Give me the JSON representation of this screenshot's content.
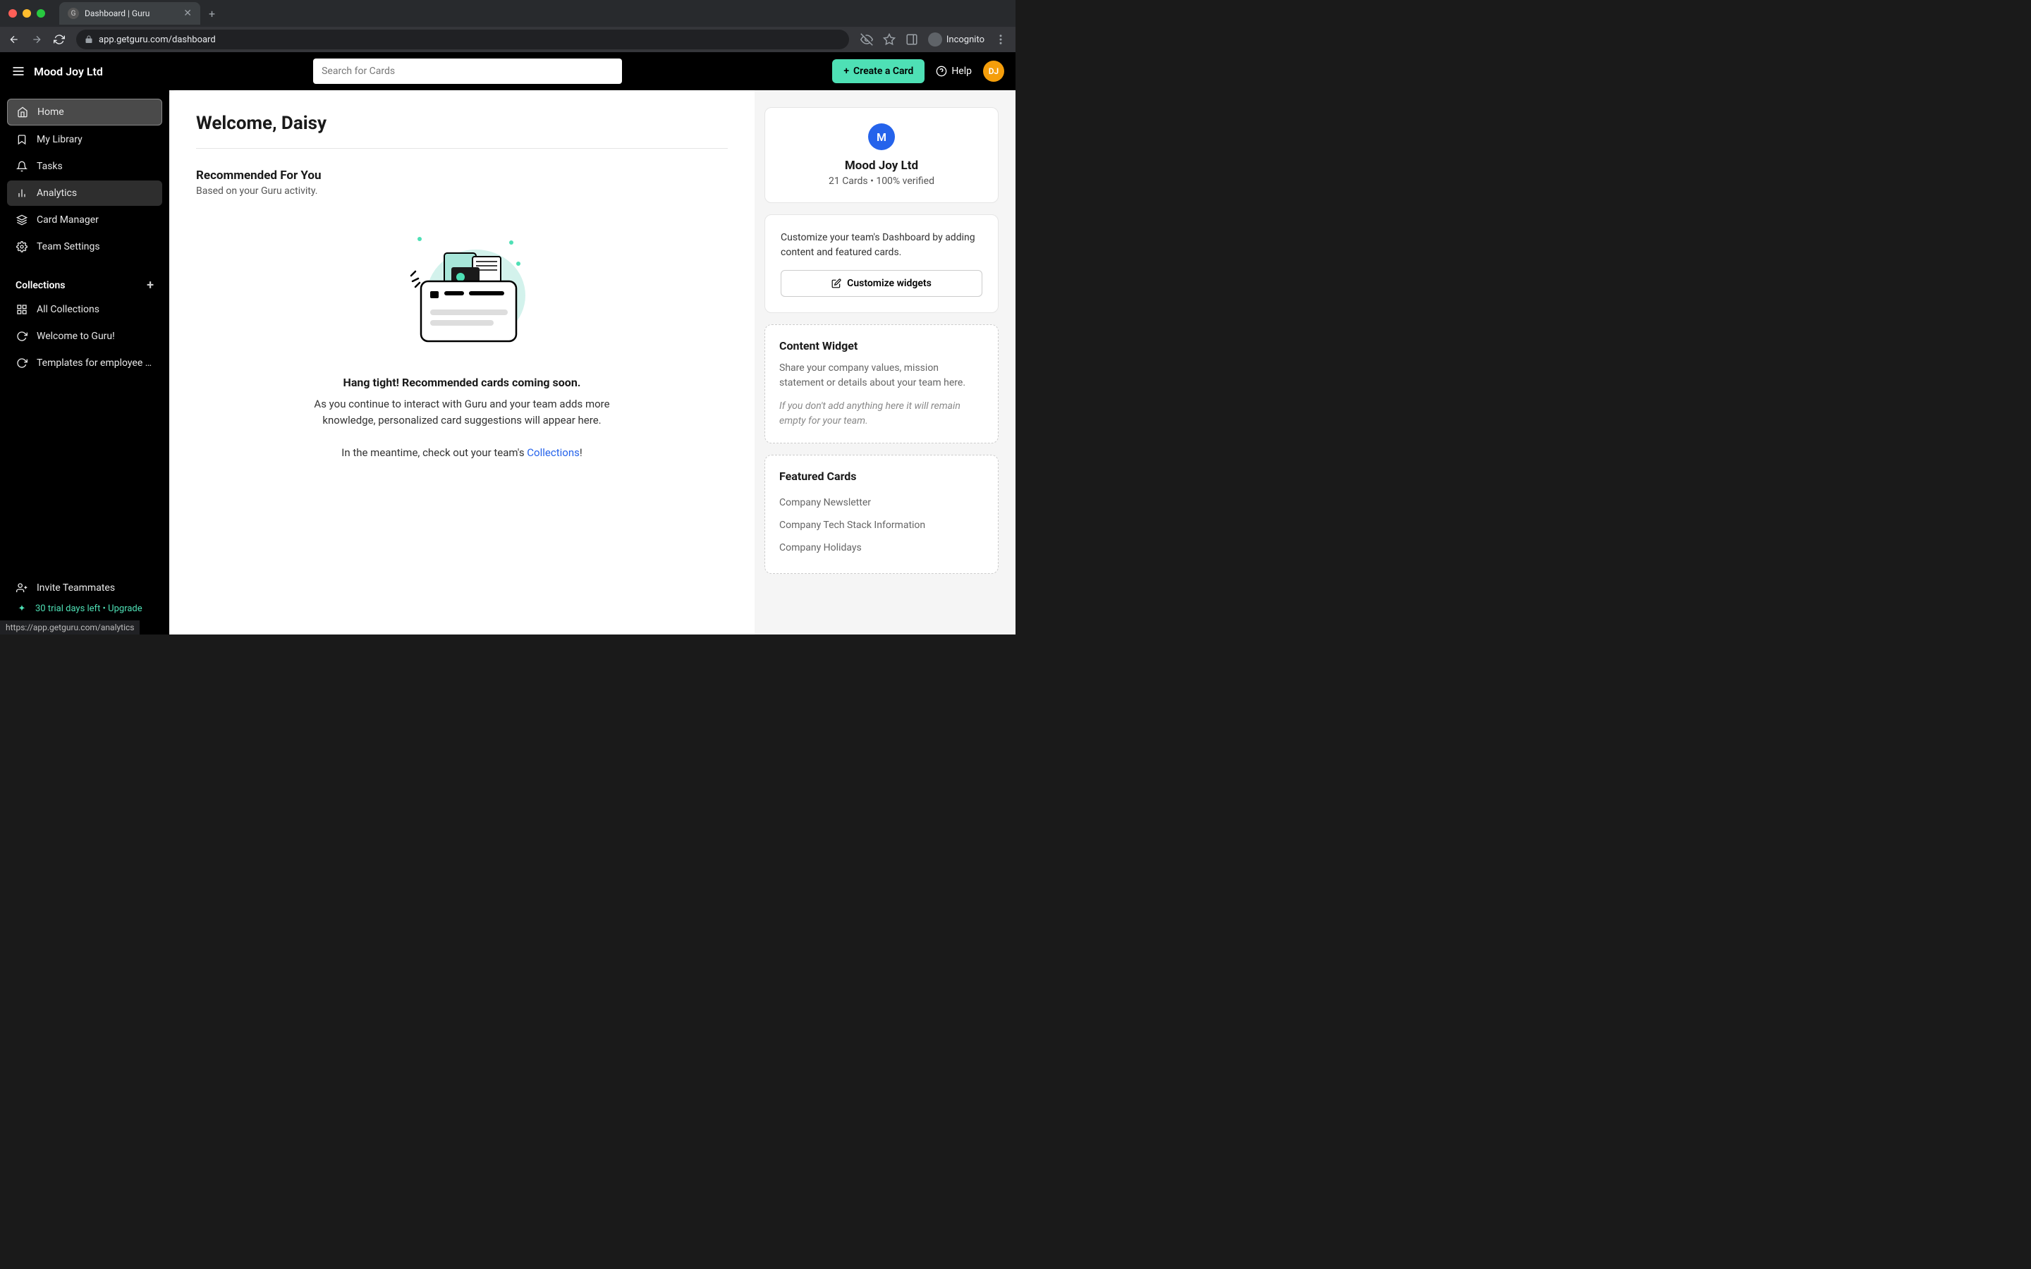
{
  "browser": {
    "tab_title": "Dashboard | Guru",
    "url": "app.getguru.com/dashboard",
    "incognito_label": "Incognito",
    "status_bar_url": "https://app.getguru.com/analytics"
  },
  "header": {
    "app_title": "Mood Joy Ltd",
    "search_placeholder": "Search for Cards",
    "create_card_label": "Create a Card",
    "help_label": "Help",
    "avatar_initials": "DJ"
  },
  "sidebar": {
    "items": [
      {
        "label": "Home"
      },
      {
        "label": "My Library"
      },
      {
        "label": "Tasks"
      },
      {
        "label": "Analytics"
      },
      {
        "label": "Card Manager"
      },
      {
        "label": "Team Settings"
      }
    ],
    "collections": {
      "title": "Collections",
      "items": [
        {
          "label": "All Collections"
        },
        {
          "label": "Welcome to Guru!"
        },
        {
          "label": "Templates for employee …"
        }
      ]
    },
    "invite_label": "Invite Teammates",
    "trial_label": "30 trial days left • Upgrade"
  },
  "main": {
    "welcome_title": "Welcome, Daisy",
    "rec_title": "Recommended For You",
    "rec_sub": "Based on your Guru activity.",
    "empty_title": "Hang tight! Recommended cards coming soon.",
    "empty_desc": "As you continue to interact with Guru and your team adds more knowledge, personalized card suggestions will appear here.",
    "empty_cta_prefix": "In the meantime, check out your team's ",
    "empty_cta_link": "Collections",
    "empty_cta_suffix": "!"
  },
  "right": {
    "team_avatar_letter": "M",
    "team_name": "Mood Joy Ltd",
    "team_stats": "21 Cards • 100% verified",
    "customize_text": "Customize your team's Dashboard by adding content and featured cards.",
    "customize_btn": "Customize widgets",
    "content_widget": {
      "title": "Content Widget",
      "text": "Share your company values, mission statement or details about your team here.",
      "italic": "If you don't add anything here it will remain empty for your team."
    },
    "featured": {
      "title": "Featured Cards",
      "items": [
        "Company Newsletter",
        "Company Tech Stack Information",
        "Company Holidays"
      ]
    }
  }
}
